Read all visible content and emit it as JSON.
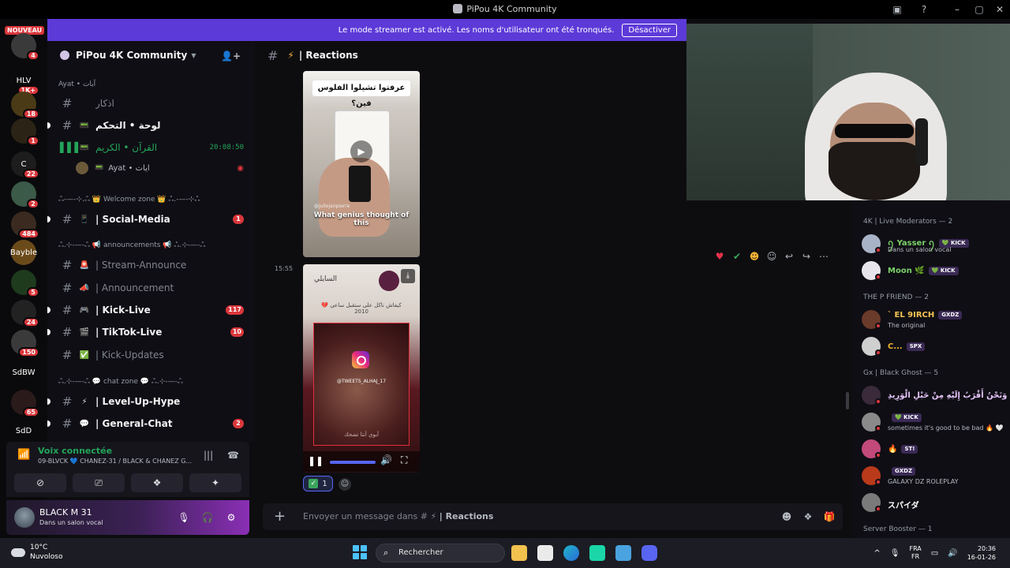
{
  "window": {
    "title": "PiPou 4K Community"
  },
  "banner": {
    "text": "Le mode streamer est activé. Les noms d'utilisateur ont été tronqués.",
    "button": "Désactiver"
  },
  "rail": {
    "new_label": "NOUVEAU",
    "servers": [
      {
        "label": "",
        "badge": "4",
        "color": "#3a3a3a"
      },
      {
        "label": "HLV",
        "badge": "1K+",
        "color": "#0a0a0c"
      },
      {
        "label": "",
        "badge": "18",
        "color": "#4a3a16"
      },
      {
        "label": "",
        "badge": "1",
        "color": "#2b2416"
      },
      {
        "label": "C",
        "badge": "22",
        "color": "#1d1d1d"
      },
      {
        "label": "",
        "badge": "2",
        "color": "#3b5a48"
      },
      {
        "label": "",
        "badge": "484",
        "color": "#3a2a20"
      },
      {
        "label": "Bayble",
        "badge": "",
        "color": "#6b4a1a"
      },
      {
        "label": "",
        "badge": "5",
        "color": "#1e3b1e"
      },
      {
        "label": "",
        "badge": "24",
        "color": "#222"
      },
      {
        "label": "",
        "badge": "150",
        "color": "#3a3a3a"
      },
      {
        "label": "SdBW",
        "badge": "",
        "color": "#0a0a0c"
      },
      {
        "label": "",
        "badge": "65",
        "color": "#2a1a1a"
      },
      {
        "label": "SdD",
        "badge": "",
        "color": "#0a0a0c"
      }
    ]
  },
  "guild": {
    "name": "PiPou 4K Community"
  },
  "channels": [
    {
      "kind": "category",
      "label": "Ayat • آيات"
    },
    {
      "kind": "text",
      "emoji": "",
      "label": "اذكار",
      "style": "dim"
    },
    {
      "kind": "text",
      "emoji": "📟",
      "label": "لوحة • التحكم",
      "style": "bold"
    },
    {
      "kind": "voice",
      "emoji": "📟",
      "label": "القرآن • الكريم",
      "time": "20:08:50",
      "style": "voice"
    },
    {
      "kind": "voice-user",
      "label": "Ayat • آيات"
    },
    {
      "kind": "category",
      "label": "ஃ-—-⊹.ஃ 👑 Welcome zone 👑 ஃ.-—-⊹ஃ"
    },
    {
      "kind": "text",
      "emoji": "📱",
      "label": "| Social-Media",
      "style": "bold",
      "count": "1"
    },
    {
      "kind": "category",
      "label": "ஃ.⊹-—-ஃ 📢 announcements 📢 ஃ.⊹-—-ஃ"
    },
    {
      "kind": "text",
      "emoji": "🚨",
      "label": "| Stream-Announce",
      "style": "dim"
    },
    {
      "kind": "text",
      "emoji": "📣",
      "label": "| Announcement",
      "style": "dim"
    },
    {
      "kind": "text",
      "emoji": "🎮",
      "label": "| Kick-Live",
      "style": "bold",
      "count": "117"
    },
    {
      "kind": "text",
      "emoji": "🎬",
      "label": "| TikTok-Live",
      "style": "bold",
      "count": "10"
    },
    {
      "kind": "text",
      "emoji": "✅",
      "label": "| Kick-Updates",
      "style": "dim"
    },
    {
      "kind": "category",
      "label": "ஃ.⊹-—-ஃ 💬 chat zone 💬 ஃ.⊹-—-ஃ"
    },
    {
      "kind": "text",
      "emoji": "⚡",
      "label": "| Level-Up-Hype",
      "style": "bold"
    },
    {
      "kind": "text",
      "emoji": "💬",
      "label": "| General-Chat",
      "style": "bold",
      "count": "2"
    }
  ],
  "voice": {
    "status": "Voix connectée",
    "sub": "09-BLVCK 💙 CHANEZ-31 / BLACK & CHANEZ G..."
  },
  "user": {
    "name": "BLACK M 31",
    "sub": "Dans un salon vocal"
  },
  "chat": {
    "channel_emoji": "⚡",
    "channel_name": "| Reactions",
    "media1": {
      "caption_top": "عرفتوا تشيلوا الفلوس فين؟",
      "handle": "@juliojanpierre",
      "caption_bottom": "What genius thought of this"
    },
    "timestamp": "15:55",
    "media2": {
      "top_name": "السايلي",
      "quote": "كيفاش ناكل على ستقبل ساعي 💔 2010",
      "instagram_handle": "@TWEETS_ALHAJ_17",
      "arabic_footer": "أبوي أنتا تضحك"
    },
    "reaction": {
      "emoji": "✓",
      "count": "1"
    },
    "composer": {
      "placeholder_prefix": "Envoyer un message dans #",
      "placeholder_emoji": "⚡",
      "placeholder_channel": "| Reactions"
    }
  },
  "members": {
    "groups": [
      {
        "title": "4K | Live Moderators — 2",
        "members": [
          {
            "name": "ꪆ Yasser ꪆ",
            "tag": "💚 KICK",
            "sub": "Dans un salon vocal",
            "color": "#7bd36a",
            "avatar": "#a9b3c8"
          },
          {
            "name": "Moon 🌿",
            "tag": "💚 KICK",
            "sub": "",
            "color": "#7bd36a",
            "avatar": "#e8e6ec"
          }
        ]
      },
      {
        "title": "THE P FRIEND — 2",
        "members": [
          {
            "name": "ˋ EL 9IRCH",
            "tag": "GXDZ",
            "sub": "The original",
            "color": "#f6c453",
            "avatar": "#6a3a2a"
          },
          {
            "name": "C...",
            "tag": "SPX",
            "sub": "",
            "color": "#f0b232",
            "avatar": "#cfcfcf"
          }
        ]
      },
      {
        "title": "Gx | Black Ghost — 5",
        "members": [
          {
            "name": "وَنَحْنُ أَقْرَبُ إِلَيْهِ مِنْ حَبْلِ الْوَرِيدِ 💗",
            "tag": "",
            "sub": "",
            "color": "#e7c6ff",
            "avatar": "#3a2a3a"
          },
          {
            "name": "",
            "tag": "💚 KICK",
            "sub": "sometimes it's good to be bad 🔥 🤍",
            "color": "#ffffff",
            "avatar": "#8a8a8a"
          },
          {
            "name": "🔥",
            "tag": "ST!",
            "sub": "",
            "color": "#ffffff",
            "avatar": "#c14a7a"
          },
          {
            "name": "",
            "tag": "GXDZ",
            "sub": "GALAXY DZ ROLEPLAY",
            "color": "#ffffff",
            "avatar": "#b83a1a"
          },
          {
            "name": "スパイダ",
            "tag": "",
            "sub": "",
            "color": "#ffffff",
            "avatar": "#7a7a7a"
          }
        ]
      },
      {
        "title": "Server Booster — 1",
        "members": []
      }
    ]
  },
  "taskbar": {
    "weather_temp": "10°C",
    "weather_desc": "Nuvoloso",
    "search": "Rechercher",
    "lang_top": "FRA",
    "lang_bot": "FR",
    "time": "20:36",
    "date": "16-01-26"
  }
}
